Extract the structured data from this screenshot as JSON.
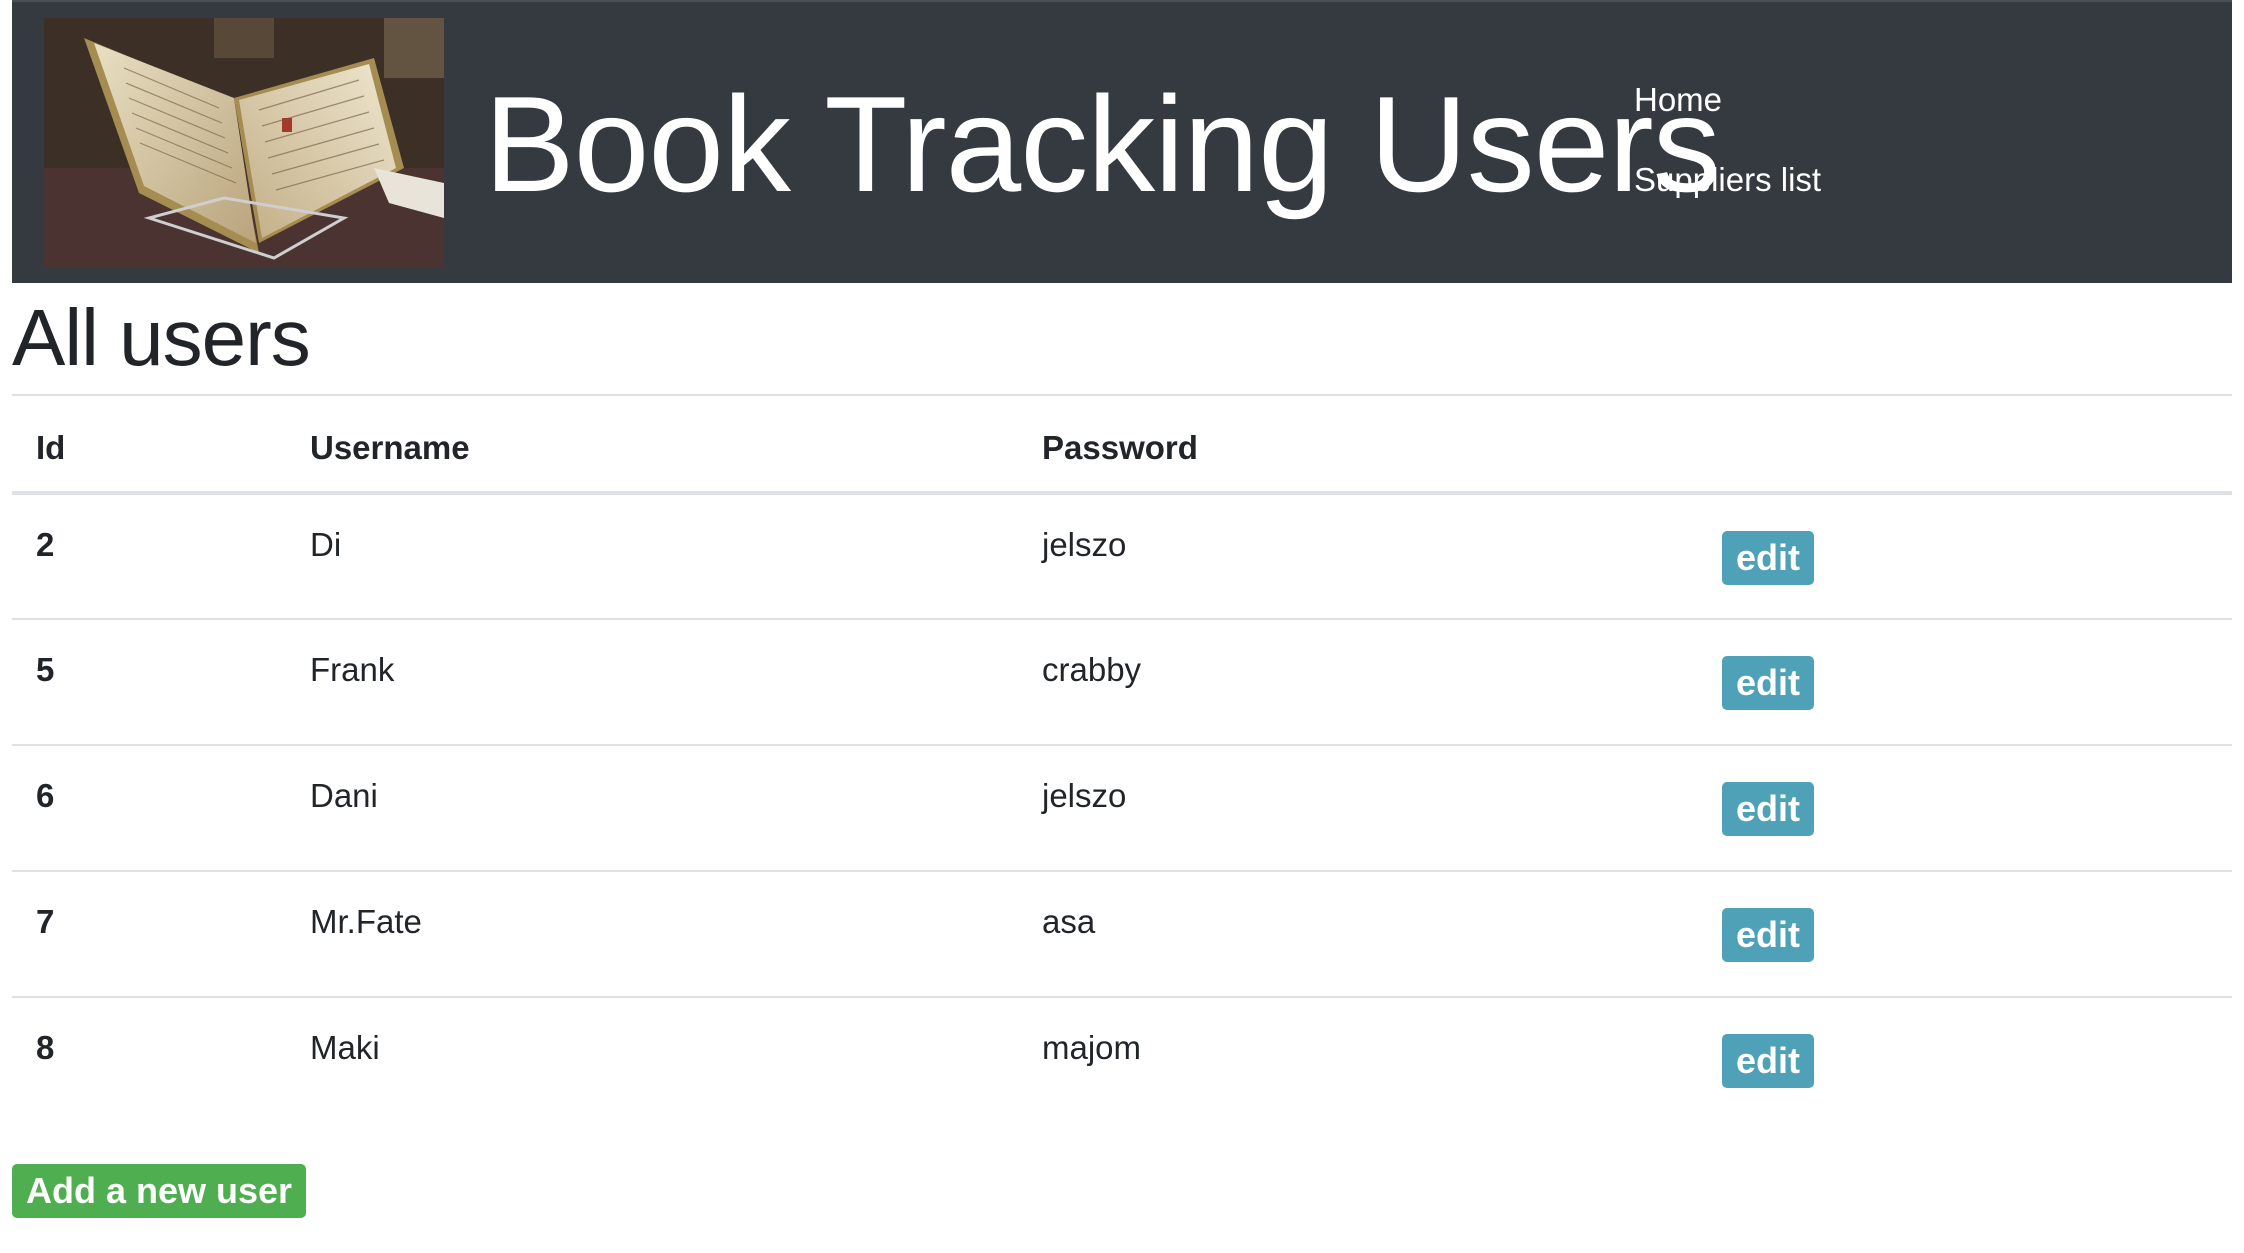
{
  "header": {
    "brand_title": "Book Tracking Users",
    "logo_alt": "open-book-photo",
    "nav": [
      {
        "label": "Home"
      },
      {
        "label": "Suppliers list"
      }
    ],
    "background_color": "#343a40"
  },
  "main": {
    "page_title": "All users",
    "table": {
      "columns": [
        "Id",
        "Username",
        "Password",
        ""
      ],
      "rows": [
        {
          "id": "2",
          "username": "Di",
          "password": "jelszo",
          "action": "edit"
        },
        {
          "id": "5",
          "username": "Frank",
          "password": "crabby",
          "action": "edit"
        },
        {
          "id": "6",
          "username": "Dani",
          "password": "jelszo",
          "action": "edit"
        },
        {
          "id": "7",
          "username": "Mr.Fate",
          "password": "asa",
          "action": "edit"
        },
        {
          "id": "8",
          "username": "Maki",
          "password": "majom",
          "action": "edit"
        }
      ]
    },
    "add_button_label": "Add a new user"
  },
  "colors": {
    "edit_button": "#4fa1b8",
    "add_button": "#4fae50",
    "text": "#212529"
  }
}
